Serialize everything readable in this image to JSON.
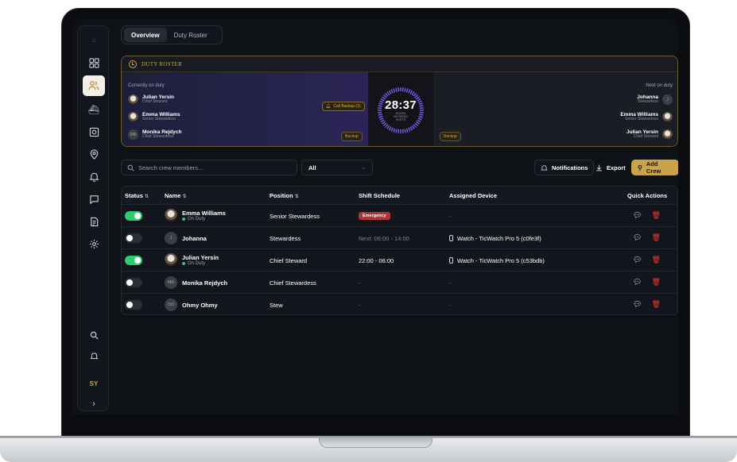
{
  "tabs": [
    {
      "label": "Overview",
      "active": true
    },
    {
      "label": "Duty Roster",
      "active": false
    }
  ],
  "sidebar": {
    "user_initials": "SY",
    "expand_glyph": "›",
    "accent": "#c9a24a"
  },
  "roster": {
    "title": "DUTY ROSTER",
    "current_label": "Currently on duty",
    "next_label": "Next on duty",
    "call_backup": "Call Backup (1)",
    "backup_label": "Backup",
    "timer": "28:37",
    "timer_sub": "HOURS BETWEEN SHIFTS",
    "current": [
      {
        "name": "Julian Yersin",
        "role": "Chief Steward"
      },
      {
        "name": "Emma Williams",
        "role": "Senior Stewardess"
      },
      {
        "name": "Monika Rejdych",
        "role": "Chief Stewardess",
        "initials": "MR"
      }
    ],
    "next": [
      {
        "name": "Johanna",
        "role": "Stewardess",
        "initials": "J"
      },
      {
        "name": "Emma Williams",
        "role": "Senior Stewardess"
      },
      {
        "name": "Julian Yersin",
        "role": "Chief Steward"
      }
    ]
  },
  "toolbar": {
    "search_placeholder": "Search crew members...",
    "filter_value": "All",
    "notifications": "Notifications",
    "export": "Export",
    "add_crew": "Add Crew"
  },
  "table": {
    "headers": {
      "status": "Status",
      "name": "Name",
      "position": "Position",
      "shift": "Shift Schedule",
      "device": "Assigned Device",
      "actions": "Quick Actions"
    },
    "sort_glyph": "⇅",
    "on_duty_label": "On Duty",
    "rows": [
      {
        "on": true,
        "name": "Emma Williams",
        "initials": "",
        "on_duty": true,
        "position": "Senior Stewardess",
        "shift": "",
        "emergency": "Emergency",
        "device": "-"
      },
      {
        "on": false,
        "name": "Johanna",
        "initials": "J",
        "on_duty": false,
        "position": "Stewardess",
        "shift": "Next: 06:00 - 14:00",
        "device": "Watch - TicWatch Pro 5 (c0fe3f)"
      },
      {
        "on": true,
        "name": "Julian Yersin",
        "initials": "",
        "on_duty": true,
        "position": "Chief Steward",
        "shift": "22:00 - 06:00",
        "device": "Watch - TicWatch Pro 5 (c53bdb)"
      },
      {
        "on": false,
        "name": "Monika Rejdych",
        "initials": "MR",
        "on_duty": false,
        "position": "Chief Stewardess",
        "shift": "-",
        "device": "-"
      },
      {
        "on": false,
        "name": "Ohmy Ohmy",
        "initials": "OO",
        "on_duty": false,
        "position": "Stew",
        "shift": "-",
        "device": "-"
      }
    ]
  }
}
